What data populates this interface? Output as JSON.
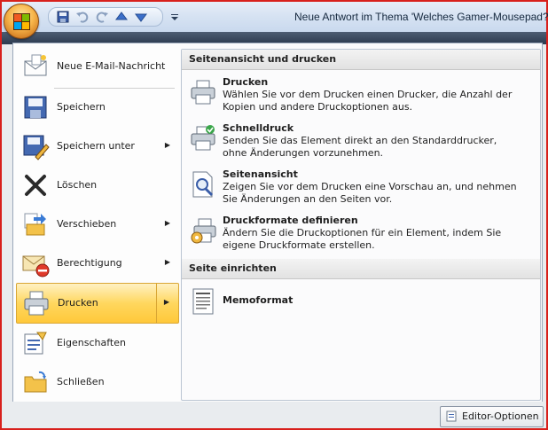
{
  "window": {
    "title": "Neue Antwort im Thema 'Welches Gamer-Mousepad?"
  },
  "quick_access": [
    "save-icon",
    "undo-icon",
    "redo-icon",
    "arrow-up-icon",
    "arrow-down-icon",
    "customize-icon"
  ],
  "menu": {
    "items": [
      {
        "label": "Neue E-Mail-Nachricht",
        "icon": "new-mail-icon",
        "submenu": false
      },
      {
        "label": "Speichern",
        "icon": "save-icon",
        "submenu": false
      },
      {
        "label": "Speichern unter",
        "icon": "save-as-icon",
        "submenu": true
      },
      {
        "label": "Löschen",
        "icon": "delete-icon",
        "submenu": false
      },
      {
        "label": "Verschieben",
        "icon": "move-icon",
        "submenu": true
      },
      {
        "label": "Berechtigung",
        "icon": "permission-icon",
        "submenu": true
      },
      {
        "label": "Drucken",
        "icon": "print-icon",
        "submenu": true,
        "selected": true
      },
      {
        "label": "Eigenschaften",
        "icon": "properties-icon",
        "submenu": false
      },
      {
        "label": "Schließen",
        "icon": "close-folder-icon",
        "submenu": false
      }
    ]
  },
  "submenu": {
    "section1": "Seitenansicht und drucken",
    "entries": [
      {
        "title": "Drucken",
        "desc": "Wählen Sie vor dem Drucken einen Drucker, die Anzahl der Kopien und andere Druckoptionen aus."
      },
      {
        "title": "Schnelldruck",
        "desc": "Senden Sie das Element direkt an den Standarddrucker, ohne Änderungen vorzunehmen."
      },
      {
        "title": "Seitenansicht",
        "desc": "Zeigen Sie vor dem Drucken eine Vorschau an, und nehmen Sie Änderungen an den Seiten vor."
      },
      {
        "title": "Druckformate definieren",
        "desc": "Ändern Sie die Druckoptionen für ein Element, indem Sie eigene Druckformate erstellen."
      }
    ],
    "section2": "Seite einrichten",
    "memo": "Memoformat"
  },
  "footer": {
    "options_label": "Editor-Optionen"
  },
  "colors": {
    "accent": "#ffd75e",
    "frame": "#d8201c"
  }
}
